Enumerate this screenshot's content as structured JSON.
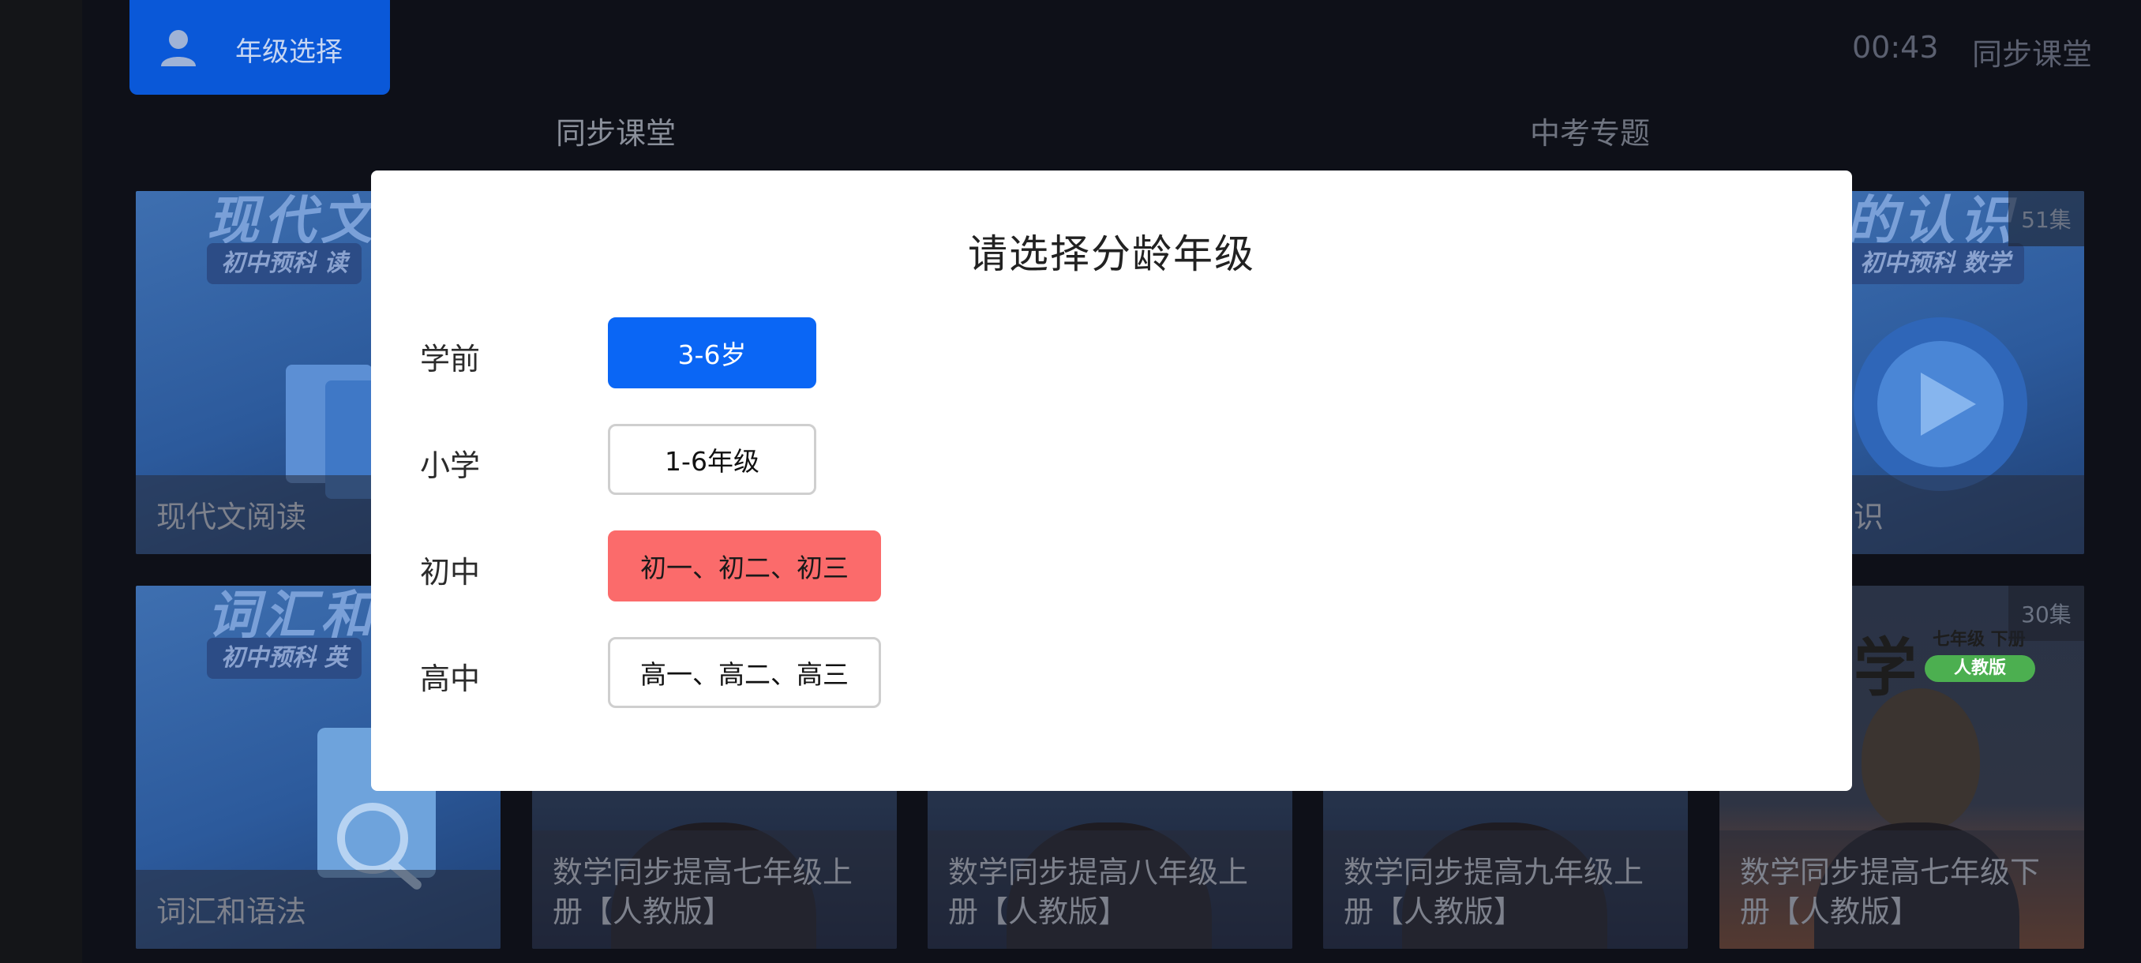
{
  "header": {
    "grade_button_label": "年级选择",
    "clock": "00:43",
    "app_name": "同步课堂"
  },
  "tabs": [
    {
      "label": "同步课堂",
      "active": true
    },
    {
      "label": "中考专题",
      "active": false
    }
  ],
  "cards_row1": [
    {
      "title_art": "现代文阅",
      "badge": "初中预科 读",
      "caption": "现代文阅读",
      "count": ""
    },
    {
      "title_art": "的认识",
      "badge": "初中预科 数学",
      "caption": "识",
      "count": "51集"
    }
  ],
  "cards_row2": [
    {
      "title_art": "词汇和语",
      "badge": "初中预科 英",
      "caption": "词汇和语法",
      "count": ""
    },
    {
      "caption": "数学同步提高七年级上册【人教版】",
      "count": ""
    },
    {
      "caption": "数学同步提高八年级上册【人教版】",
      "count": ""
    },
    {
      "caption": "数学同步提高九年级上册【人教版】",
      "count": ""
    },
    {
      "caption": "数学同步提高七年级下册【人教版】",
      "count": "30集",
      "sub_grade": "七年级 下册",
      "sub_edition": "人教版",
      "art_char": "学"
    }
  ],
  "dialog": {
    "title": "请选择分龄年级",
    "rows": [
      {
        "label": "学前",
        "option": "3-6岁",
        "style": "selected-blue"
      },
      {
        "label": "小学",
        "option": "1-6年级",
        "style": "outline"
      },
      {
        "label": "初中",
        "option": "初一、初二、初三",
        "style": "highlight-red"
      },
      {
        "label": "高中",
        "option": "高一、高二、高三",
        "style": "outline"
      }
    ]
  },
  "colors": {
    "accent_blue": "#0a66f5",
    "accent_red": "#fb6b6b",
    "grade_button": "#0a58d8"
  }
}
